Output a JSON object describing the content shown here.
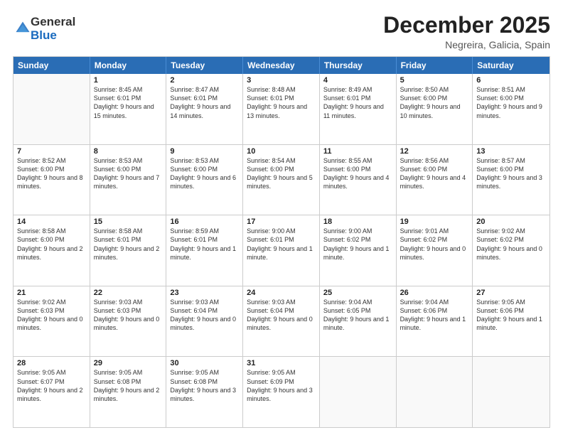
{
  "logo": {
    "general": "General",
    "blue": "Blue"
  },
  "title": "December 2025",
  "location": "Negreira, Galicia, Spain",
  "days": [
    "Sunday",
    "Monday",
    "Tuesday",
    "Wednesday",
    "Thursday",
    "Friday",
    "Saturday"
  ],
  "weeks": [
    [
      {
        "date": "",
        "empty": true
      },
      {
        "date": "1",
        "sunrise": "8:45 AM",
        "sunset": "6:01 PM",
        "daylight": "9 hours and 15 minutes."
      },
      {
        "date": "2",
        "sunrise": "8:47 AM",
        "sunset": "6:01 PM",
        "daylight": "9 hours and 14 minutes."
      },
      {
        "date": "3",
        "sunrise": "8:48 AM",
        "sunset": "6:01 PM",
        "daylight": "9 hours and 13 minutes."
      },
      {
        "date": "4",
        "sunrise": "8:49 AM",
        "sunset": "6:01 PM",
        "daylight": "9 hours and 11 minutes."
      },
      {
        "date": "5",
        "sunrise": "8:50 AM",
        "sunset": "6:00 PM",
        "daylight": "9 hours and 10 minutes."
      },
      {
        "date": "6",
        "sunrise": "8:51 AM",
        "sunset": "6:00 PM",
        "daylight": "9 hours and 9 minutes."
      }
    ],
    [
      {
        "date": "7",
        "sunrise": "8:52 AM",
        "sunset": "6:00 PM",
        "daylight": "9 hours and 8 minutes."
      },
      {
        "date": "8",
        "sunrise": "8:53 AM",
        "sunset": "6:00 PM",
        "daylight": "9 hours and 7 minutes."
      },
      {
        "date": "9",
        "sunrise": "8:53 AM",
        "sunset": "6:00 PM",
        "daylight": "9 hours and 6 minutes."
      },
      {
        "date": "10",
        "sunrise": "8:54 AM",
        "sunset": "6:00 PM",
        "daylight": "9 hours and 5 minutes."
      },
      {
        "date": "11",
        "sunrise": "8:55 AM",
        "sunset": "6:00 PM",
        "daylight": "9 hours and 4 minutes."
      },
      {
        "date": "12",
        "sunrise": "8:56 AM",
        "sunset": "6:00 PM",
        "daylight": "9 hours and 4 minutes."
      },
      {
        "date": "13",
        "sunrise": "8:57 AM",
        "sunset": "6:00 PM",
        "daylight": "9 hours and 3 minutes."
      }
    ],
    [
      {
        "date": "14",
        "sunrise": "8:58 AM",
        "sunset": "6:00 PM",
        "daylight": "9 hours and 2 minutes."
      },
      {
        "date": "15",
        "sunrise": "8:58 AM",
        "sunset": "6:01 PM",
        "daylight": "9 hours and 2 minutes."
      },
      {
        "date": "16",
        "sunrise": "8:59 AM",
        "sunset": "6:01 PM",
        "daylight": "9 hours and 1 minute."
      },
      {
        "date": "17",
        "sunrise": "9:00 AM",
        "sunset": "6:01 PM",
        "daylight": "9 hours and 1 minute."
      },
      {
        "date": "18",
        "sunrise": "9:00 AM",
        "sunset": "6:02 PM",
        "daylight": "9 hours and 1 minute."
      },
      {
        "date": "19",
        "sunrise": "9:01 AM",
        "sunset": "6:02 PM",
        "daylight": "9 hours and 0 minutes."
      },
      {
        "date": "20",
        "sunrise": "9:02 AM",
        "sunset": "6:02 PM",
        "daylight": "9 hours and 0 minutes."
      }
    ],
    [
      {
        "date": "21",
        "sunrise": "9:02 AM",
        "sunset": "6:03 PM",
        "daylight": "9 hours and 0 minutes."
      },
      {
        "date": "22",
        "sunrise": "9:03 AM",
        "sunset": "6:03 PM",
        "daylight": "9 hours and 0 minutes."
      },
      {
        "date": "23",
        "sunrise": "9:03 AM",
        "sunset": "6:04 PM",
        "daylight": "9 hours and 0 minutes."
      },
      {
        "date": "24",
        "sunrise": "9:03 AM",
        "sunset": "6:04 PM",
        "daylight": "9 hours and 0 minutes."
      },
      {
        "date": "25",
        "sunrise": "9:04 AM",
        "sunset": "6:05 PM",
        "daylight": "9 hours and 1 minute."
      },
      {
        "date": "26",
        "sunrise": "9:04 AM",
        "sunset": "6:06 PM",
        "daylight": "9 hours and 1 minute."
      },
      {
        "date": "27",
        "sunrise": "9:05 AM",
        "sunset": "6:06 PM",
        "daylight": "9 hours and 1 minute."
      }
    ],
    [
      {
        "date": "28",
        "sunrise": "9:05 AM",
        "sunset": "6:07 PM",
        "daylight": "9 hours and 2 minutes."
      },
      {
        "date": "29",
        "sunrise": "9:05 AM",
        "sunset": "6:08 PM",
        "daylight": "9 hours and 2 minutes."
      },
      {
        "date": "30",
        "sunrise": "9:05 AM",
        "sunset": "6:08 PM",
        "daylight": "9 hours and 3 minutes."
      },
      {
        "date": "31",
        "sunrise": "9:05 AM",
        "sunset": "6:09 PM",
        "daylight": "9 hours and 3 minutes."
      },
      {
        "date": "",
        "empty": true
      },
      {
        "date": "",
        "empty": true
      },
      {
        "date": "",
        "empty": true
      }
    ]
  ]
}
